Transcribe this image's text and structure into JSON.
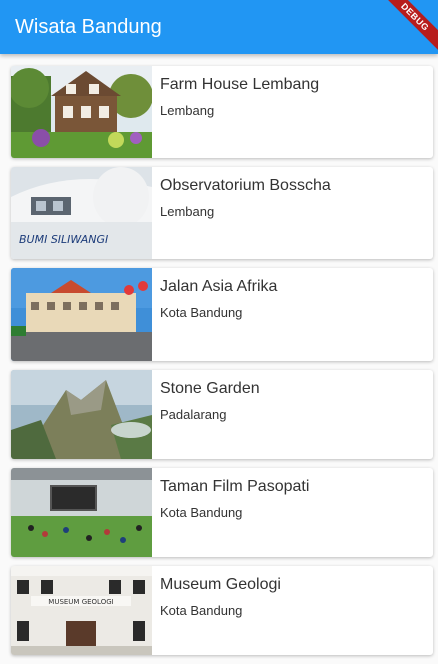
{
  "appbar": {
    "title": "Wisata Bandung",
    "color": "#2196f3"
  },
  "debug_banner": {
    "label": "DEBUG"
  },
  "places": [
    {
      "name": "Farm House Lembang",
      "location": "Lembang",
      "image": "farm-house-photo"
    },
    {
      "name": "Observatorium Bosscha",
      "location": "Lembang",
      "image": "observatory-photo"
    },
    {
      "name": "Jalan Asia Afrika",
      "location": "Kota Bandung",
      "image": "street-photo"
    },
    {
      "name": "Stone Garden",
      "location": "Padalarang",
      "image": "rock-mountain-photo"
    },
    {
      "name": "Taman Film Pasopati",
      "location": "Kota Bandung",
      "image": "park-screen-photo"
    },
    {
      "name": "Museum Geologi",
      "location": "Kota Bandung",
      "image": "museum-facade-photo",
      "sign_text": "MUSEUM GEOLOGI"
    }
  ],
  "observatory_sign_text": "BUMI SILIWANGI"
}
